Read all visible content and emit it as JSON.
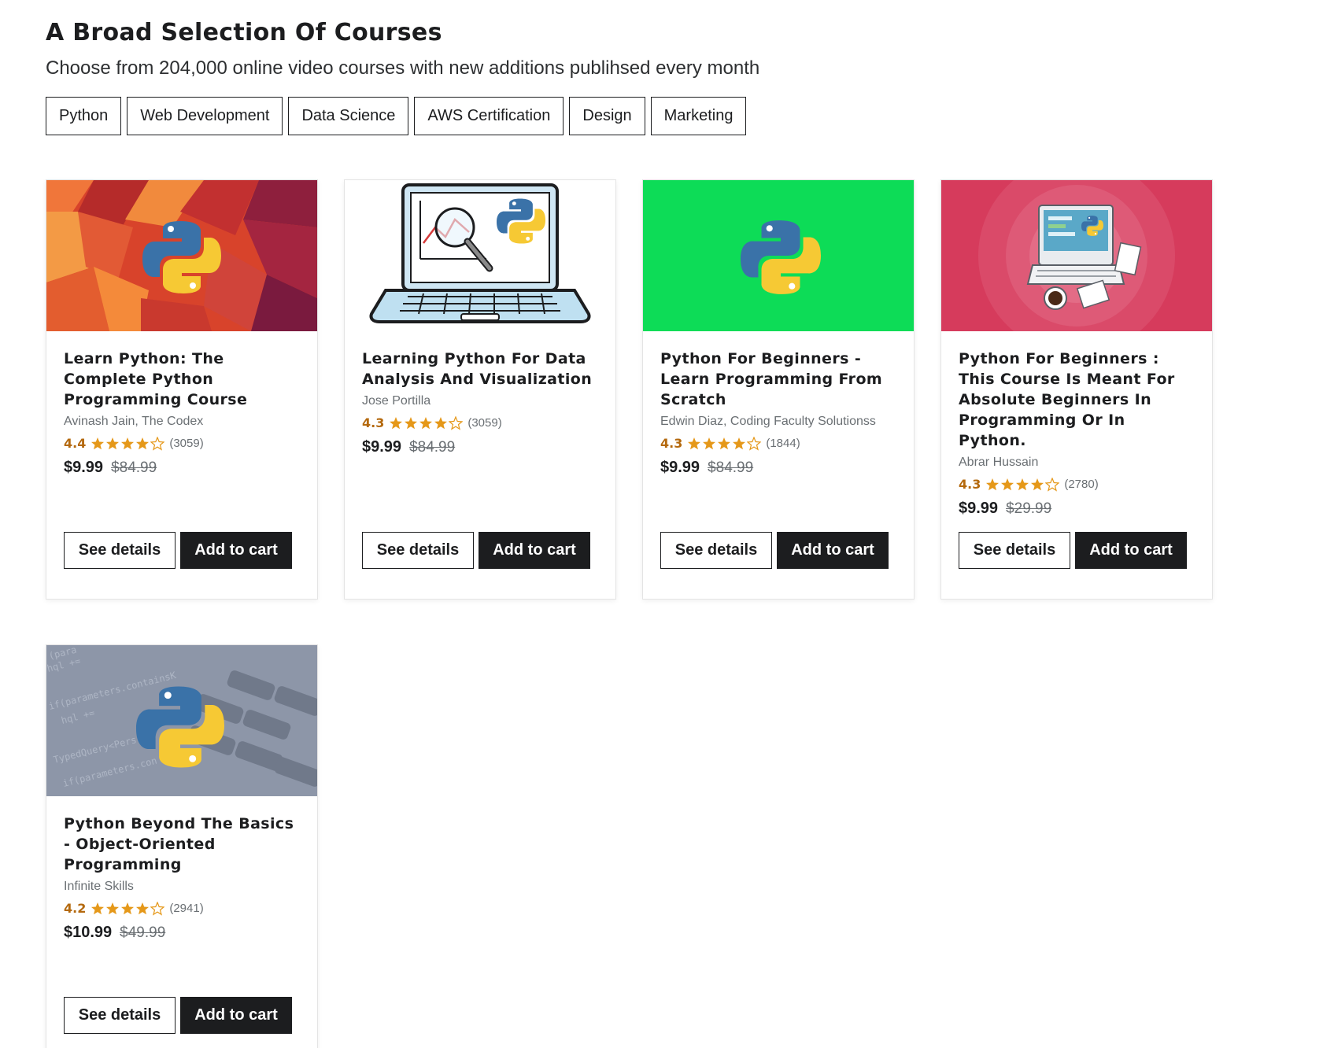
{
  "section": {
    "title": "A Broad Selection Of Courses",
    "subtitle": "Choose from 204,000 online video courses with new additions publihsed every month"
  },
  "filters": [
    "Python",
    "Web Development",
    "Data Science",
    "AWS Certification",
    "Design",
    "Marketing"
  ],
  "colors": {
    "star": "#e59819",
    "rating": "#b4690e",
    "dark_button": "#1c1d1f"
  },
  "buttons": {
    "details_label": "See details",
    "cart_label": "Add to cart"
  },
  "courses": [
    {
      "title": "Learn Python: The Complete Python Programming Course",
      "author": "Avinash Jain, The Codex",
      "rating": "4.4",
      "stars_filled": 4,
      "reviews": "(3059)",
      "price": "$9.99",
      "old_price": "$84.99",
      "thumbnail": "python-logo-red-geometric"
    },
    {
      "title": "Learning Python For Data Analysis And Visualization",
      "author": "Jose Portilla",
      "rating": "4.3",
      "stars_filled": 4,
      "reviews": "(3059)",
      "price": "$9.99",
      "old_price": "$84.99",
      "thumbnail": "laptop-chart-python-sketch"
    },
    {
      "title": "Python For Beginners - Learn Programming From Scratch",
      "author": "Edwin Diaz, Coding Faculty Solutionss",
      "rating": "4.3",
      "stars_filled": 4,
      "reviews": "(1844)",
      "price": "$9.99",
      "old_price": "$84.99",
      "thumbnail": "python-logo-green"
    },
    {
      "title": "Python For Beginners : This Course Is Meant For Absolute Beginners In Programming Or In Python.",
      "author": "Abrar Hussain",
      "rating": "4.3",
      "stars_filled": 4,
      "reviews": "(2780)",
      "price": "$9.99",
      "old_price": "$29.99",
      "thumbnail": "laptop-desk-pink"
    },
    {
      "title": "Python Beyond The Basics - Object-Oriented Programming",
      "author": "Infinite Skills",
      "rating": "4.2",
      "stars_filled": 4,
      "reviews": "(2941)",
      "price": "$10.99",
      "old_price": "$49.99",
      "thumbnail": "python-logo-keyboard-code"
    }
  ]
}
